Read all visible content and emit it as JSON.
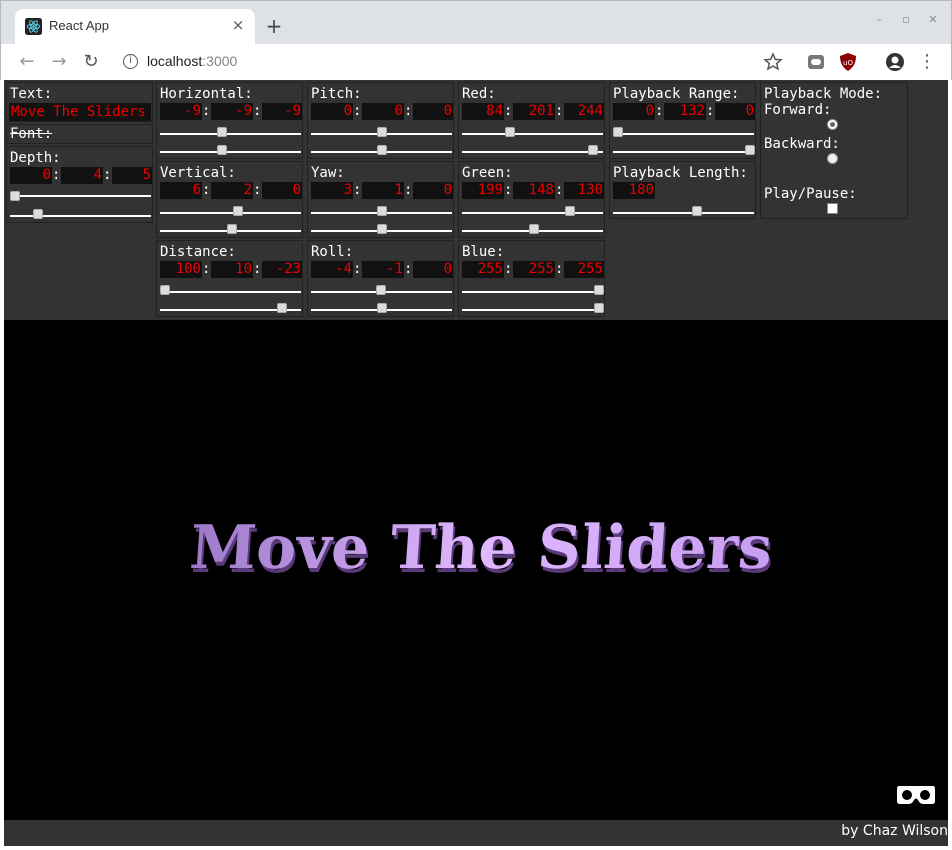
{
  "browser": {
    "tab_title": "React App",
    "tab_close": "×",
    "new_tab": "+",
    "url_host": "localhost",
    "url_port": ":3000"
  },
  "controls": {
    "text": {
      "label": "Text:",
      "value": "Move The Sliders"
    },
    "font": {
      "label": "Font:"
    },
    "depth": {
      "label": "Depth:",
      "values": [
        "0",
        "4",
        "5"
      ]
    },
    "horizontal": {
      "label": "Horizontal:",
      "values": [
        "-9",
        "-9",
        "-9"
      ]
    },
    "vertical": {
      "label": "Vertical:",
      "values": [
        "6",
        "2",
        "0"
      ]
    },
    "distance": {
      "label": "Distance:",
      "values": [
        "100",
        "10",
        "-23"
      ]
    },
    "pitch": {
      "label": "Pitch:",
      "values": [
        "0",
        "0",
        "0"
      ]
    },
    "yaw": {
      "label": "Yaw:",
      "values": [
        "3",
        "1",
        "0"
      ]
    },
    "roll": {
      "label": "Roll:",
      "values": [
        "-4",
        "-1",
        "0"
      ]
    },
    "red": {
      "label": "Red:",
      "values": [
        "84",
        "201",
        "244"
      ]
    },
    "green": {
      "label": "Green:",
      "values": [
        "199",
        "148",
        "130"
      ]
    },
    "blue": {
      "label": "Blue:",
      "values": [
        "255",
        "255",
        "255"
      ]
    },
    "playback_range": {
      "label": "Playback Range:",
      "values": [
        "0",
        "132",
        "0"
      ]
    },
    "playback_length": {
      "label": "Playback Length:",
      "value": "180"
    },
    "playback_mode": {
      "label": "Playback Mode:",
      "forward": "Forward:",
      "backward": "Backward:",
      "selected": "forward"
    },
    "play_pause": {
      "label": "Play/Pause:",
      "checked": false
    }
  },
  "scene": {
    "text": "Move The Sliders",
    "text_color": "#d9a7f5"
  },
  "footer": {
    "credit": "by Chaz Wilson"
  }
}
